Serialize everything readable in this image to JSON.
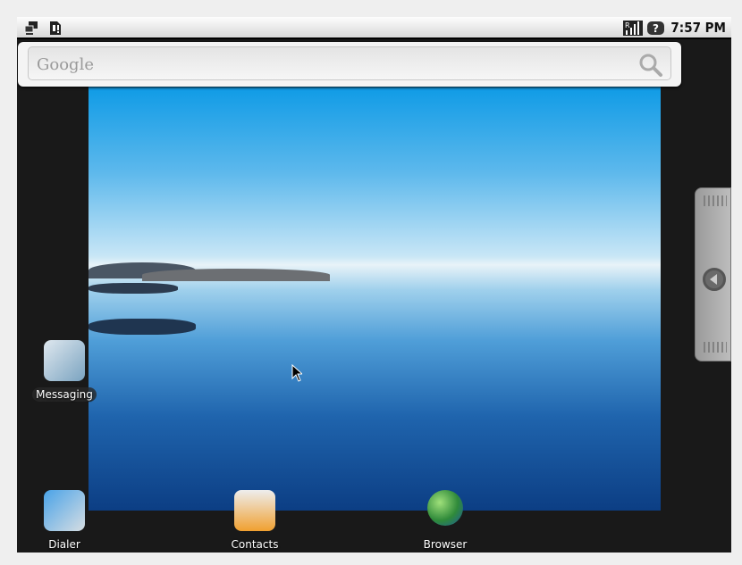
{
  "status_bar": {
    "time": "7:57 PM",
    "left_icons": [
      "network-icon",
      "sim-card-alert-icon"
    ],
    "right_icons": [
      "signal-roaming-icon",
      "unknown-icon"
    ]
  },
  "search": {
    "logo": "Google",
    "icon": "search-icon"
  },
  "apps": {
    "messaging": "Messaging",
    "dialer": "Dialer",
    "contacts": "Contacts",
    "browser": "Browser"
  },
  "colors": {
    "screen_bg": "#191919",
    "outer_bg": "#efefef"
  }
}
